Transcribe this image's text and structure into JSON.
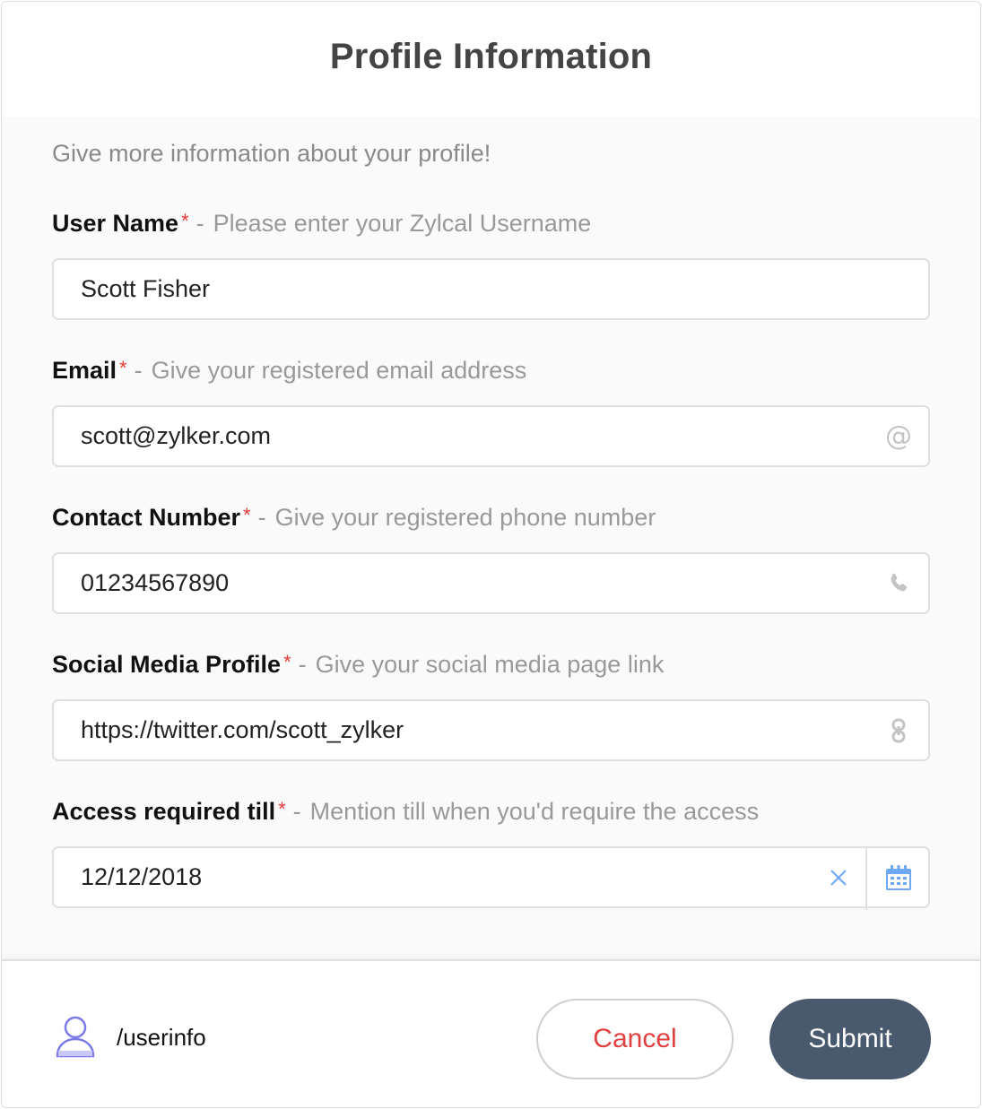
{
  "header": {
    "title": "Profile Information"
  },
  "intro": "Give more information about your profile!",
  "fields": [
    {
      "label": "User Name",
      "required_mark": "*",
      "separator": "-",
      "hint": "Please enter your Zylcal Username",
      "value": "Scott Fisher",
      "icon": ""
    },
    {
      "label": "Email",
      "required_mark": "*",
      "separator": "-",
      "hint": "Give your registered email address",
      "value": "scott@zylker.com",
      "icon": "at-icon"
    },
    {
      "label": "Contact Number",
      "required_mark": "*",
      "separator": "-",
      "hint": "Give your registered phone number",
      "value": "01234567890",
      "icon": "phone-icon"
    },
    {
      "label": "Social Media Profile",
      "required_mark": "*",
      "separator": "-",
      "hint": "Give your social media page link",
      "value": "https://twitter.com/scott_zylker",
      "icon": "link-icon"
    },
    {
      "label": "Access required till",
      "required_mark": "*",
      "separator": "-",
      "hint": "Mention till when you'd require the access",
      "value": "12/12/2018",
      "icon": "calendar-icon"
    }
  ],
  "footer": {
    "route": "/userinfo",
    "cancel_label": "Cancel",
    "submit_label": "Submit"
  },
  "colors": {
    "required": "#e53935",
    "cancel_text": "#e04040",
    "submit_bg": "#4a5a6e",
    "date_icons": "#6ea8f5",
    "user_icon": "#7b7be8"
  }
}
